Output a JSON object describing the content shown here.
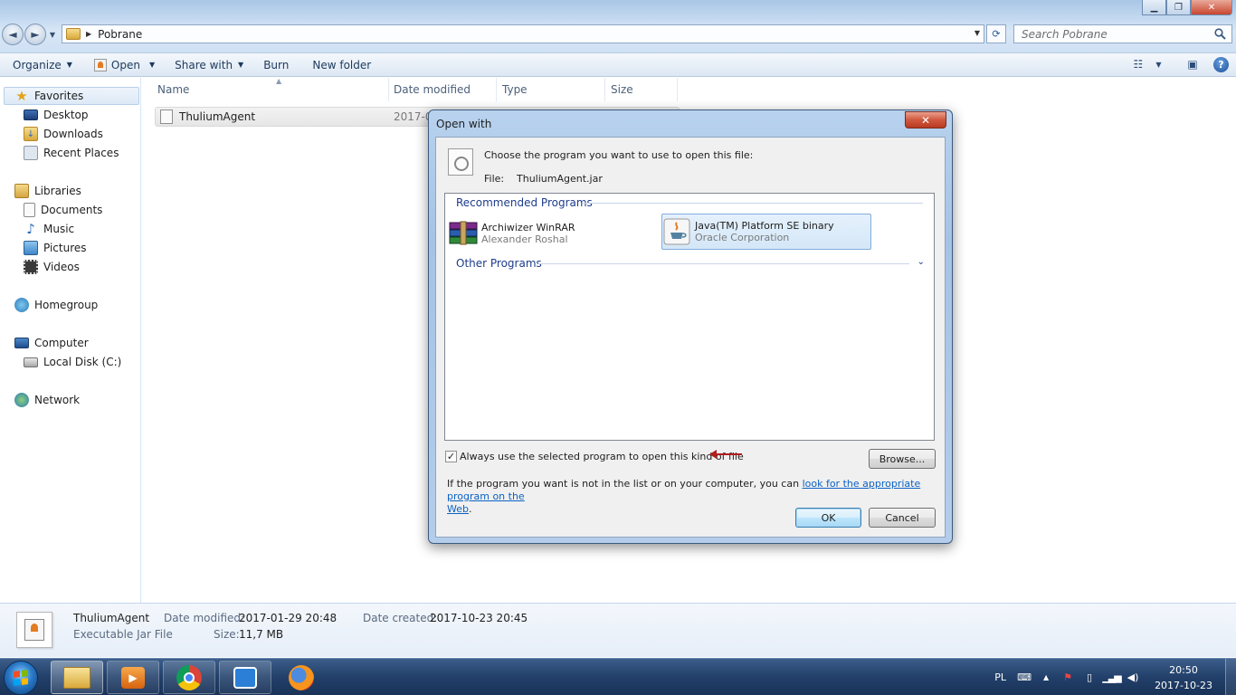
{
  "window": {
    "breadcrumb": "Pobrane",
    "search_placeholder": "Search Pobrane"
  },
  "toolbar": {
    "organize": "Organize",
    "open": "Open",
    "share_with": "Share with",
    "burn": "Burn",
    "new_folder": "New folder"
  },
  "nav": {
    "favorites": "Favorites",
    "desktop": "Desktop",
    "downloads": "Downloads",
    "recent_places": "Recent Places",
    "libraries": "Libraries",
    "documents": "Documents",
    "music": "Music",
    "pictures": "Pictures",
    "videos": "Videos",
    "homegroup": "Homegroup",
    "computer": "Computer",
    "local_disk": "Local Disk (C:)",
    "network": "Network"
  },
  "columns": {
    "name": "Name",
    "date_modified": "Date modified",
    "type": "Type",
    "size": "Size"
  },
  "file": {
    "name": "ThuliumAgent",
    "date_partial": "2017-01"
  },
  "dialog": {
    "title": "Open with",
    "close_glyph": "✕",
    "prompt": "Choose the program you want to use to open this file:",
    "file_label": "File:",
    "file_name": "ThuliumAgent.jar",
    "recommended_header": "Recommended Programs",
    "other_header": "Other Programs",
    "programs": [
      {
        "name": "Archiwizer WinRAR",
        "company": "Alexander Roshal",
        "selected": false
      },
      {
        "name": "Java(TM) Platform SE binary",
        "company": "Oracle Corporation",
        "selected": true
      }
    ],
    "always_use_label": "Always use the selected program to open this kind of file",
    "always_use_checked": true,
    "browse": "Browse...",
    "help_text_prefix": "If the program you want is not in the list or on your computer, you can",
    "help_link_line1": "look for the appropriate program on the",
    "help_link_line2": "Web",
    "help_text_suffix": ".",
    "ok": "OK",
    "cancel": "Cancel"
  },
  "details": {
    "name": "ThuliumAgent",
    "type": "Executable Jar File",
    "date_modified_label": "Date modified:",
    "date_modified": "2017-01-29 20:48",
    "size_label": "Size:",
    "size": "11,7 MB",
    "date_created_label": "Date created:",
    "date_created": "2017-10-23 20:45"
  },
  "taskbar": {
    "language": "PL",
    "time": "20:50",
    "date": "2017-10-23"
  },
  "icons": {
    "back": "◄",
    "forward": "►",
    "refresh": "⟳",
    "search": "search-icon",
    "favorites": "★",
    "music": "♪",
    "help": "?"
  },
  "colors": {
    "accent": "#1e3c8c",
    "link": "#0b62c4",
    "annotation_arrow": "#b11e1e",
    "close_red": "#c8452f"
  }
}
